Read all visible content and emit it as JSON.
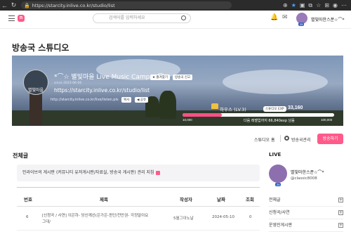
{
  "browser": {
    "url": "https://starcity.inlive.co.kr/studio/list"
  },
  "header": {
    "search_placeholder": "검색어를 입력하세요",
    "username": "별빛마한스푼☆⌒*"
  },
  "page_title": "방송국 스튜디오",
  "banner": {
    "avatar_label": "별빛마을",
    "title": "*⌒☆ 별빛마을 Live Music Camp ☆⌒*",
    "fav_button": "즐겨찾기",
    "report_button": "방송국 신고",
    "since": "since 2023-06-06",
    "studio_link": "https://starcity.inlive.co.kr/studio/list",
    "live_link": "http://starcity.inlive.co.kr/live/listen.pls",
    "copy_button": "복사",
    "share_button": "공유",
    "level_name": "하우스 (LV.3)",
    "exp_label": "스튜디오 EXP",
    "exp_value": "33,160",
    "bar_min": "10,000",
    "bar_next": "다음 레벨업까지 66,840exp 남음",
    "bar_max": "100,000",
    "progress_fraction": 0.2573
  },
  "actions": {
    "studio_home": "스튜디오 홈",
    "studio_manage": "방송국관리",
    "broadcast": "방송하기"
  },
  "board": {
    "title": "전체글",
    "notice": "인라이브의 게시판 (커뮤니티 유저게시판/자료실, 방송국 게시판) 관리 지침",
    "columns": [
      "번호",
      "제목",
      "작성자",
      "날짜",
      "조회"
    ],
    "rows": [
      {
        "number": "6",
        "title_line1": "[신청곡 / 사연] 이은하- 당신께선(은가은-퀸단/천만권- 각정말아요",
        "title_line2": "그대/",
        "author": "5월그이노날",
        "date": "2024-05-10",
        "views": "0"
      }
    ]
  },
  "sidebar": {
    "live_title": "LIVE",
    "live_name": "별빛마한스푼☆⌒*",
    "live_id": "@classic8008",
    "items": [
      "전체글",
      "신청곡/사연",
      "운영진게시판"
    ]
  }
}
